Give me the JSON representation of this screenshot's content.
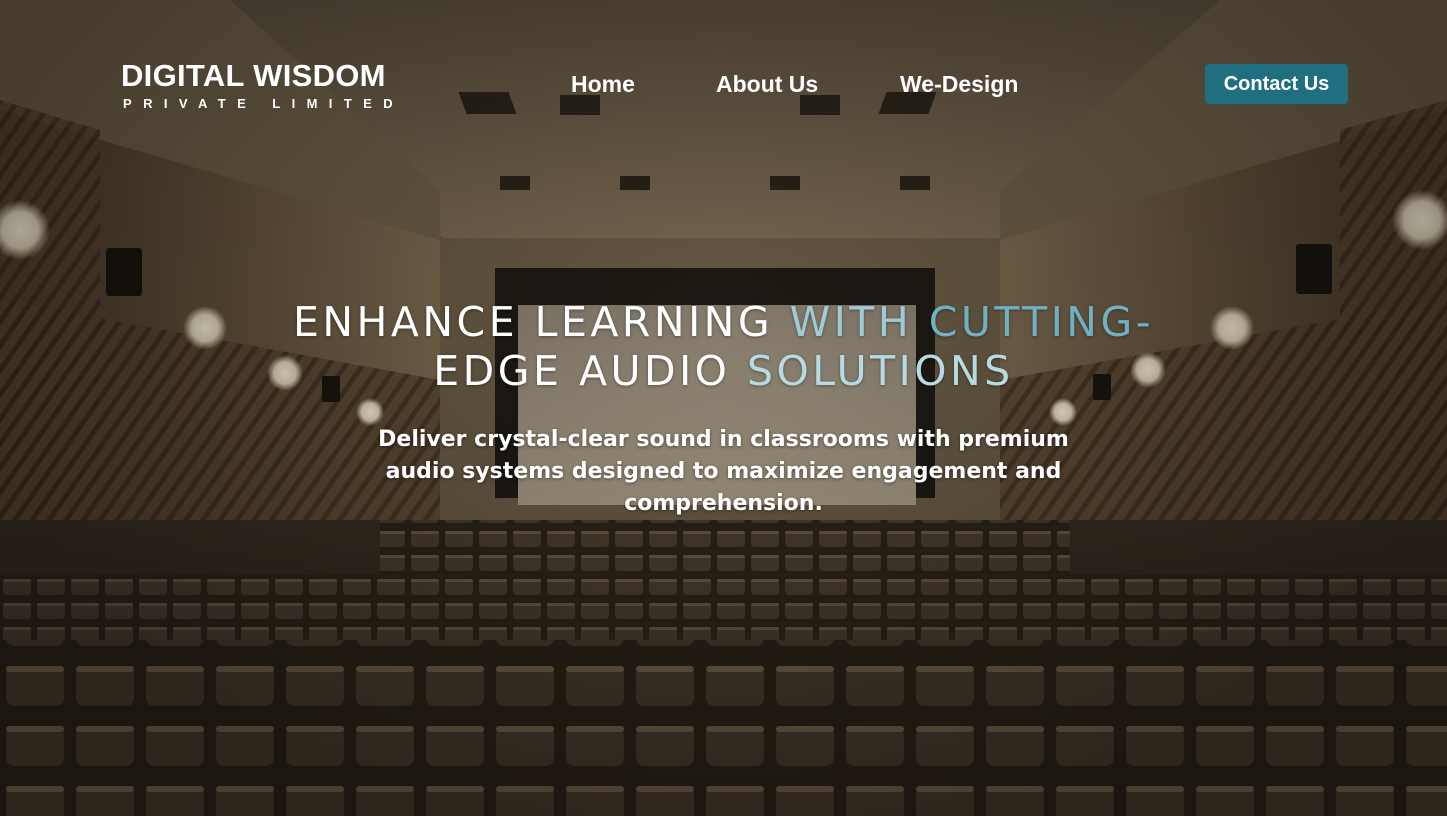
{
  "logo": {
    "title": "DIGITAL WISDOM",
    "subtitle": "PRIVATE LIMITED"
  },
  "nav": {
    "items": [
      {
        "label": "Home"
      },
      {
        "label": "About Us"
      },
      {
        "label": "We-Design"
      }
    ],
    "contact_label": "Contact Us"
  },
  "hero": {
    "headline_parts": [
      "ENHANCE LEARNING ",
      "WITH ",
      "CUTTING-",
      "EDGE AUDIO ",
      "SOLUTIONS"
    ],
    "subtext": "Deliver crystal-clear sound in classrooms with premium audio systems designed to maximize engagement and comprehension."
  },
  "colors": {
    "contact_button": "#1f6f80",
    "headline_accent": "#8fc3d0",
    "text": "#ffffff"
  },
  "background": {
    "icon": "cinema-auditorium-photo"
  }
}
